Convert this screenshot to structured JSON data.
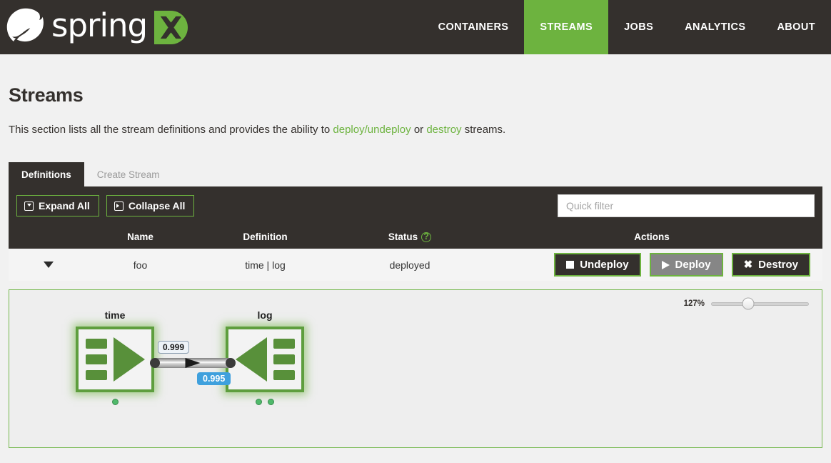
{
  "brand": {
    "word": "spring",
    "leaf_icon": "spring-leaf-logo",
    "xd_icon": "spring-xd-logo"
  },
  "nav": {
    "items": [
      {
        "label": "CONTAINERS",
        "active": false
      },
      {
        "label": "STREAMS",
        "active": true
      },
      {
        "label": "JOBS",
        "active": false
      },
      {
        "label": "ANALYTICS",
        "active": false
      },
      {
        "label": "ABOUT",
        "active": false
      }
    ],
    "active_color": "#6db33f",
    "bar_color": "#34302d"
  },
  "page": {
    "title": "Streams",
    "desc_part1": "This section lists all the stream definitions and provides the ability to ",
    "desc_link1": "deploy/undeploy",
    "desc_mid": " or ",
    "desc_link2": "destroy",
    "desc_part2": " streams.",
    "link_color": "#6db33f"
  },
  "tabs": [
    {
      "label": "Definitions",
      "active": true
    },
    {
      "label": "Create Stream",
      "active": false
    }
  ],
  "toolbar": {
    "expand_all_label": "Expand All",
    "collapse_all_label": "Collapse All",
    "quick_filter_placeholder": "Quick filter",
    "quick_filter_value": ""
  },
  "table": {
    "columns": [
      "Name",
      "Definition",
      "Status",
      "Actions"
    ],
    "status_help_glyph": "?",
    "rows": [
      {
        "expander": "▼",
        "name": "foo",
        "definition": "time | log",
        "status": "deployed",
        "actions": [
          {
            "label": "Undeploy",
            "icon": "stop-icon",
            "state": "enabled"
          },
          {
            "label": "Deploy",
            "icon": "play-icon",
            "state": "disabled"
          },
          {
            "label": "Destroy",
            "icon": "close-x-icon",
            "state": "enabled"
          }
        ]
      }
    ]
  },
  "diagram": {
    "zoom_percent": "127%",
    "zoom_thumb_position_pct": 38,
    "nodes": [
      {
        "label": "time",
        "type": "source",
        "status_dots": 1
      },
      {
        "label": "log",
        "type": "sink",
        "status_dots": 2
      }
    ],
    "link": {
      "badge_top": "0.999",
      "badge_bottom": "0.995",
      "badge_bottom_color": "#3fa0dd"
    }
  }
}
